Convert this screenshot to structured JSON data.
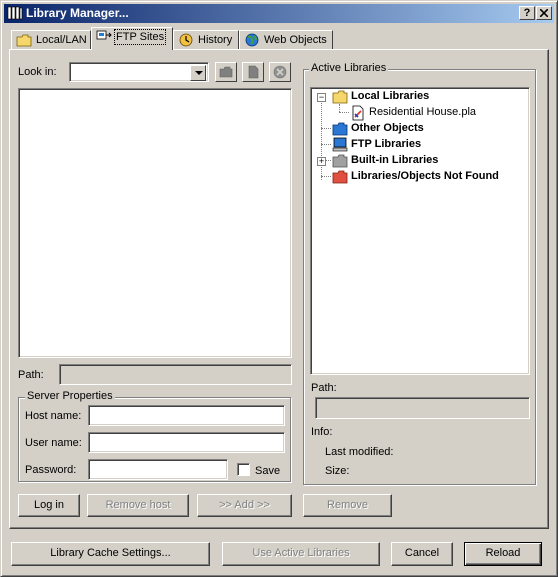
{
  "window": {
    "title": "Library Manager...",
    "help_label": "?",
    "close_label": "X"
  },
  "tabs": [
    {
      "label": "Local/LAN",
      "icon": "folder-icon",
      "active": false
    },
    {
      "label": "FTP Sites",
      "icon": "ftp-icon",
      "active": true
    },
    {
      "label": "History",
      "icon": "history-icon",
      "active": false
    },
    {
      "label": "Web Objects",
      "icon": "globe-icon",
      "active": false
    }
  ],
  "left": {
    "look_in_label": "Look in:",
    "look_in_value": "",
    "path_label": "Path:",
    "path_value": "",
    "server": {
      "title": "Server Properties",
      "host_label": "Host name:",
      "host_value": "",
      "user_label": "User name:",
      "user_value": "",
      "password_label": "Password:",
      "password_value": "",
      "save_label": "Save",
      "save_checked": false
    },
    "buttons": {
      "log_in": "Log in",
      "remove_host": "Remove host",
      "add": ">> Add >>"
    }
  },
  "right": {
    "title": "Active Libraries",
    "tree": {
      "local_libraries": "Local Libraries",
      "residential_house": "Residential House.pla",
      "other_objects": "Other Objects",
      "ftp_libraries": "FTP Libraries",
      "builtin_libraries": "Built-in Libraries",
      "not_found": "Libraries/Objects Not Found"
    },
    "path_label": "Path:",
    "path_value": "",
    "info_label": "Info:",
    "last_modified_label": "Last modified:",
    "size_label": "Size:",
    "remove_button": "Remove"
  },
  "bottom": {
    "cache_settings": "Library Cache Settings...",
    "use_active": "Use Active Libraries",
    "cancel": "Cancel",
    "reload": "Reload"
  },
  "colors": {
    "face": "#d4d0c8",
    "title_start": "#0a246a",
    "title_end": "#a6caf0",
    "folder_yellow": "#f5d76e",
    "object_blue": "#2a78d4",
    "not_found_red": "#e05040"
  }
}
